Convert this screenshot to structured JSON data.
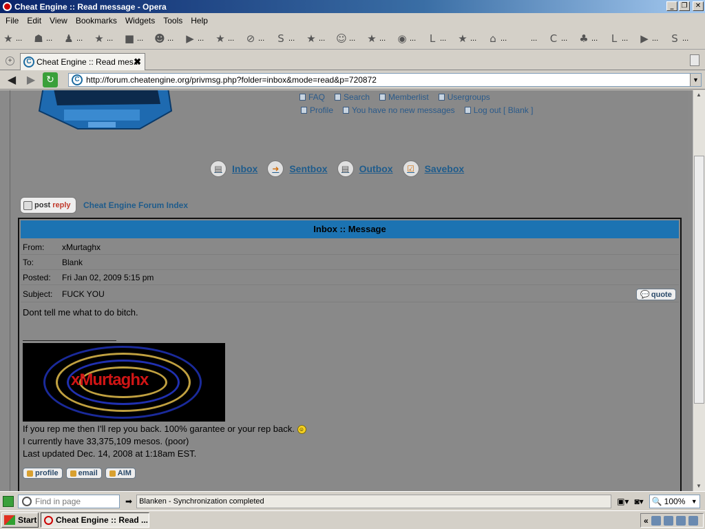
{
  "window": {
    "title": "Cheat Engine :: Read message - Opera"
  },
  "menu": [
    "File",
    "Edit",
    "View",
    "Bookmarks",
    "Widgets",
    "Tools",
    "Help"
  ],
  "bookmarks": [
    {
      "icon": "star-icon"
    },
    {
      "icon": "robot-icon"
    },
    {
      "icon": "tshirt-icon"
    },
    {
      "icon": "star-icon"
    },
    {
      "icon": "box-icon"
    },
    {
      "icon": "face-icon"
    },
    {
      "icon": "youtube-icon"
    },
    {
      "icon": "star-icon"
    },
    {
      "icon": "no-sign-icon"
    },
    {
      "icon": "s-icon"
    },
    {
      "icon": "star-icon"
    },
    {
      "icon": "people-icon"
    },
    {
      "icon": "star-icon"
    },
    {
      "icon": "eye-icon"
    },
    {
      "icon": "lmgtfy-icon"
    },
    {
      "icon": "star-icon"
    },
    {
      "icon": "hat-icon"
    },
    {
      "icon": "blank-icon"
    },
    {
      "icon": "cheatengine-icon"
    },
    {
      "icon": "sprout-icon"
    },
    {
      "icon": "lmgtfy-icon"
    },
    {
      "icon": "youtube-icon"
    },
    {
      "icon": "s-yellow-icon"
    }
  ],
  "bookmark_suffix": "...",
  "tab": {
    "title": "Cheat Engine :: Read mes...",
    "close": "✖"
  },
  "address": {
    "url": "http://forum.cheatengine.org/privmsg.php?folder=inbox&mode=read&p=720872"
  },
  "header_links": {
    "row1": [
      "FAQ",
      "Search",
      "Memberlist",
      "Usergroups"
    ],
    "row2": [
      "Profile",
      "You have no new messages",
      "Log out [ Blank ]"
    ]
  },
  "boxes": [
    "Inbox",
    "Sentbox",
    "Outbox",
    "Savebox"
  ],
  "postreply": {
    "part1": "post",
    "part2": "reply"
  },
  "forum_index": "Cheat Engine Forum Index",
  "message": {
    "heading": "Inbox :: Message",
    "from_label": "From:",
    "from": "xMurtaghx",
    "to_label": "To:",
    "to": "Blank",
    "posted_label": "Posted:",
    "posted": "Fri Jan 02, 2009 5:15 pm",
    "subject_label": "Subject:",
    "subject": "FUCK YOU",
    "quote_label": "quote",
    "body": "Dont tell me what to do bitch.",
    "sig_image_text": "xMurtaghx",
    "sig_line1": "If you rep me then I'll rep you back. 100% garantee or your rep back.",
    "sig_line2": "I currently have 33,375,109 mesos. (poor)",
    "sig_line3": "Last updated Dec. 14, 2008 at 1:18am EST.",
    "buttons": [
      "profile",
      "email",
      "AIM"
    ]
  },
  "statusbar": {
    "find_placeholder": "Find in page",
    "message": "Blanken - Synchronization completed",
    "zoom": "100%"
  },
  "taskbar": {
    "start": "Start",
    "task": "Cheat Engine :: Read ..."
  }
}
